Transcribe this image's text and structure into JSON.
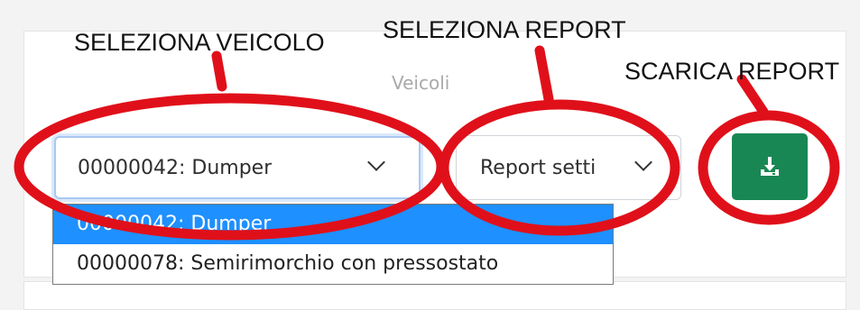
{
  "header": {
    "vehicles_label": "Veicoli"
  },
  "vehicle_select": {
    "value": "00000042: Dumper",
    "options": [
      "00000042: Dumper",
      "00000078: Semirimorchio con pressostato"
    ]
  },
  "report_select": {
    "value": "Report setti"
  },
  "download_button": {
    "icon": "download-icon",
    "color": "#198754"
  },
  "annotations": {
    "vehicle": "SELEZIONA VEICOLO",
    "report": "SELEZIONA REPORT",
    "download": "SCARICA REPORT",
    "color": "#e0101a"
  }
}
